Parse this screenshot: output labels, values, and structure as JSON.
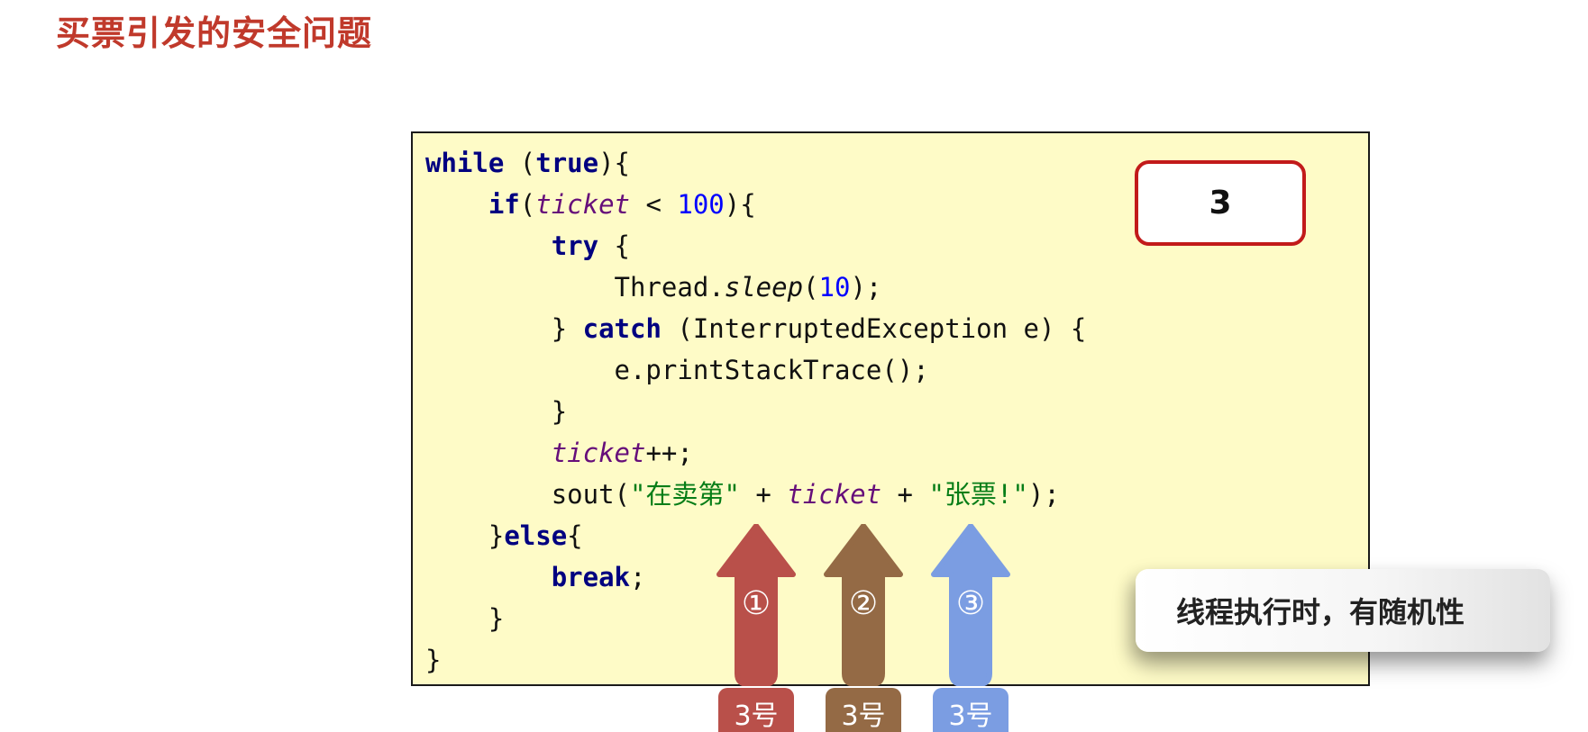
{
  "slide": {
    "title": "买票引发的安全问题"
  },
  "code": {
    "l1_kw1": "while",
    "l1_t1": " (",
    "l1_kw2": "true",
    "l1_t2": "){",
    "l2_indent": "    ",
    "l2_kw": "if",
    "l2_t1": "(",
    "l2_fld": "ticket",
    "l2_t2": " < ",
    "l2_num": "100",
    "l2_t3": "){",
    "l3_indent": "        ",
    "l3_kw": "try",
    "l3_t1": " {",
    "l4_indent": "            ",
    "l4_t1": "Thread.",
    "l4_mth": "sleep",
    "l4_t2": "(",
    "l4_num": "10",
    "l4_t3": ");",
    "l5_indent": "        ",
    "l5_t1": "} ",
    "l5_kw": "catch",
    "l5_t2": " (InterruptedException e) {",
    "l6_indent": "            ",
    "l6_t1": "e.printStackTrace();",
    "l7_indent": "        ",
    "l7_t1": "}",
    "l8_indent": "        ",
    "l8_fld": "ticket",
    "l8_t1": "++;",
    "l9_indent": "        ",
    "l9_t1": "sout(",
    "l9_str1": "\"在卖第\"",
    "l9_t2": " + ",
    "l9_fld": "ticket",
    "l9_t3": " + ",
    "l9_str2": "\"张票!\"",
    "l9_t4": ");",
    "l10_indent": "    ",
    "l10_t1": "}",
    "l10_kw": "else",
    "l10_t2": "{",
    "l11_indent": "        ",
    "l11_kw": "break",
    "l11_t1": ";",
    "l12_indent": "    ",
    "l12_t1": "}",
    "l13_t1": "}"
  },
  "counter": {
    "value": "3"
  },
  "threads": [
    {
      "number": "①",
      "tag": "3号",
      "color": "#b9504a"
    },
    {
      "number": "②",
      "tag": "3号",
      "color": "#946a45"
    },
    {
      "number": "③",
      "tag": "3号",
      "color": "#7b9de2"
    }
  ],
  "note": {
    "text": "线程执行时，有随机性"
  },
  "colors": {
    "title": "#c0392b",
    "code_background": "#fefbc7",
    "counter_border": "#c21a1a"
  }
}
